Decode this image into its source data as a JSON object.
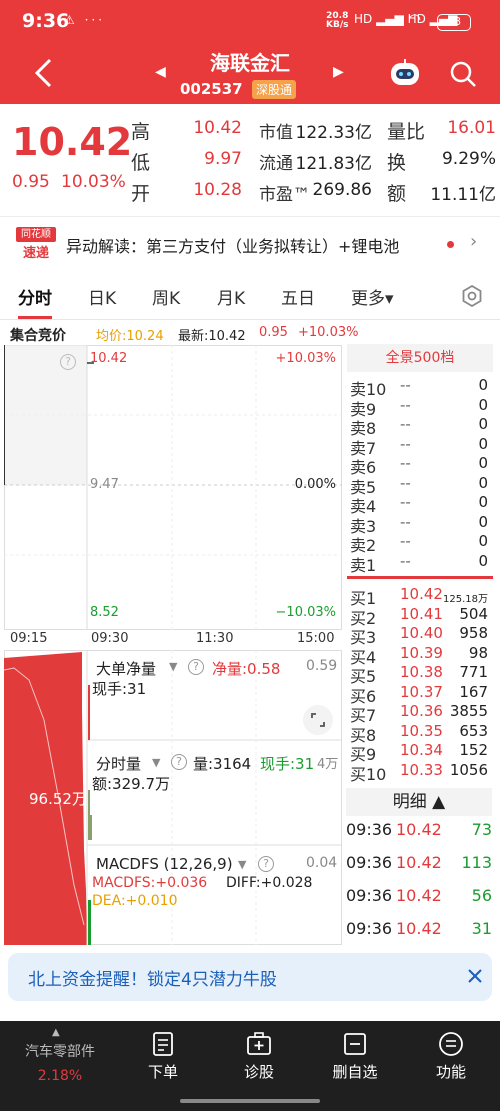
{
  "status": {
    "time": "9:36",
    "icons": "⚠ ···",
    "net_speed_value": "20.8",
    "net_speed_unit": "KB/s",
    "signal": "HD ▂▄▆ HD ▂▄▆",
    "battery": "68"
  },
  "header": {
    "stock_name": "海联金汇",
    "stock_code": "002537",
    "market_badge": "深股通"
  },
  "quote": {
    "last_price": "10.42",
    "change": "0.95",
    "change_pct": "10.03%",
    "high_label": "高",
    "high": "10.42",
    "low_label": "低",
    "low": "9.97",
    "open_label": "开",
    "open": "10.28",
    "mktcap_label": "市值",
    "mktcap": "122.33亿",
    "float_label": "流通",
    "float": "121.83亿",
    "pe_label": "市盈™",
    "pe": "269.86",
    "volratio_label": "量比",
    "volratio": "16.01",
    "turnover_label": "换",
    "turnover": "9.29%",
    "amount_label": "额",
    "amount": "11.11亿"
  },
  "news": {
    "logo_line1": "同花顺",
    "logo_line2": "速递",
    "text": "异动解读：第三方支付（业务拟转让）+锂电池"
  },
  "tabs": [
    "分时",
    "日K",
    "周K",
    "月K",
    "五日",
    "更多▾"
  ],
  "chart_head": {
    "auction": "集合竞价",
    "avg": "均价:10.24",
    "latest": "最新:10.42",
    "chg": "0.95",
    "pct": "+10.03%"
  },
  "main_chart": {
    "top_price": "10.42",
    "top_pct": "+10.03%",
    "mid_price": "9.47",
    "mid_pct": "0.00%",
    "bottom_price": "8.52",
    "bottom_pct": "−10.03%",
    "help": "?"
  },
  "time_axis": [
    "09:15",
    "09:30",
    "11:30",
    "15:00"
  ],
  "orderbook": {
    "title": "全景500档",
    "asks": [
      {
        "lvl": "卖10",
        "px": "--",
        "vol": "0"
      },
      {
        "lvl": "卖9",
        "px": "--",
        "vol": "0"
      },
      {
        "lvl": "卖8",
        "px": "--",
        "vol": "0"
      },
      {
        "lvl": "卖7",
        "px": "--",
        "vol": "0"
      },
      {
        "lvl": "卖6",
        "px": "--",
        "vol": "0"
      },
      {
        "lvl": "卖5",
        "px": "--",
        "vol": "0"
      },
      {
        "lvl": "卖4",
        "px": "--",
        "vol": "0"
      },
      {
        "lvl": "卖3",
        "px": "--",
        "vol": "0"
      },
      {
        "lvl": "卖2",
        "px": "--",
        "vol": "0"
      },
      {
        "lvl": "卖1",
        "px": "--",
        "vol": "0"
      }
    ],
    "bids": [
      {
        "lvl": "买1",
        "px": "10.42",
        "vol": "125.18万"
      },
      {
        "lvl": "买2",
        "px": "10.41",
        "vol": "504"
      },
      {
        "lvl": "买3",
        "px": "10.40",
        "vol": "958"
      },
      {
        "lvl": "买4",
        "px": "10.39",
        "vol": "98"
      },
      {
        "lvl": "买5",
        "px": "10.38",
        "vol": "771"
      },
      {
        "lvl": "买6",
        "px": "10.37",
        "vol": "167"
      },
      {
        "lvl": "买7",
        "px": "10.36",
        "vol": "3855"
      },
      {
        "lvl": "买8",
        "px": "10.35",
        "vol": "653"
      },
      {
        "lvl": "买9",
        "px": "10.34",
        "vol": "152"
      },
      {
        "lvl": "买10",
        "px": "10.33",
        "vol": "1056"
      }
    ]
  },
  "detail": {
    "title": "明细 ▲",
    "ticks": [
      {
        "time": "09:36",
        "px": "10.42",
        "vol": "73"
      },
      {
        "time": "09:36",
        "px": "10.42",
        "vol": "113"
      },
      {
        "time": "09:36",
        "px": "10.42",
        "vol": "56"
      },
      {
        "time": "09:36",
        "px": "10.42",
        "vol": "31"
      }
    ]
  },
  "subpanels": {
    "big_order_title": "大单净量",
    "big_order_net": "净量:0.58",
    "big_order_val": "0.59",
    "big_order_hand": "现手:31",
    "vol_title": "分时量",
    "vol_qty": "量:3164",
    "vol_hand": "现手:31",
    "vol_right": "4万",
    "vol_amount": "额:329.7万",
    "auction_vol": "96.52万",
    "macd_title": "MACDFS (12,26,9)",
    "macd_right": "0.04",
    "macdfs": "MACDFS:+0.036",
    "diff": "DIFF:+0.028",
    "dea": "DEA:+0.010"
  },
  "promo": {
    "text": "北上资金提醒！锁定4只潜力牛股"
  },
  "bottomnav": {
    "sector_name": "汽车零部件",
    "sector_pct": "2.18%",
    "items": [
      "下单",
      "诊股",
      "删自选",
      "功能"
    ]
  }
}
